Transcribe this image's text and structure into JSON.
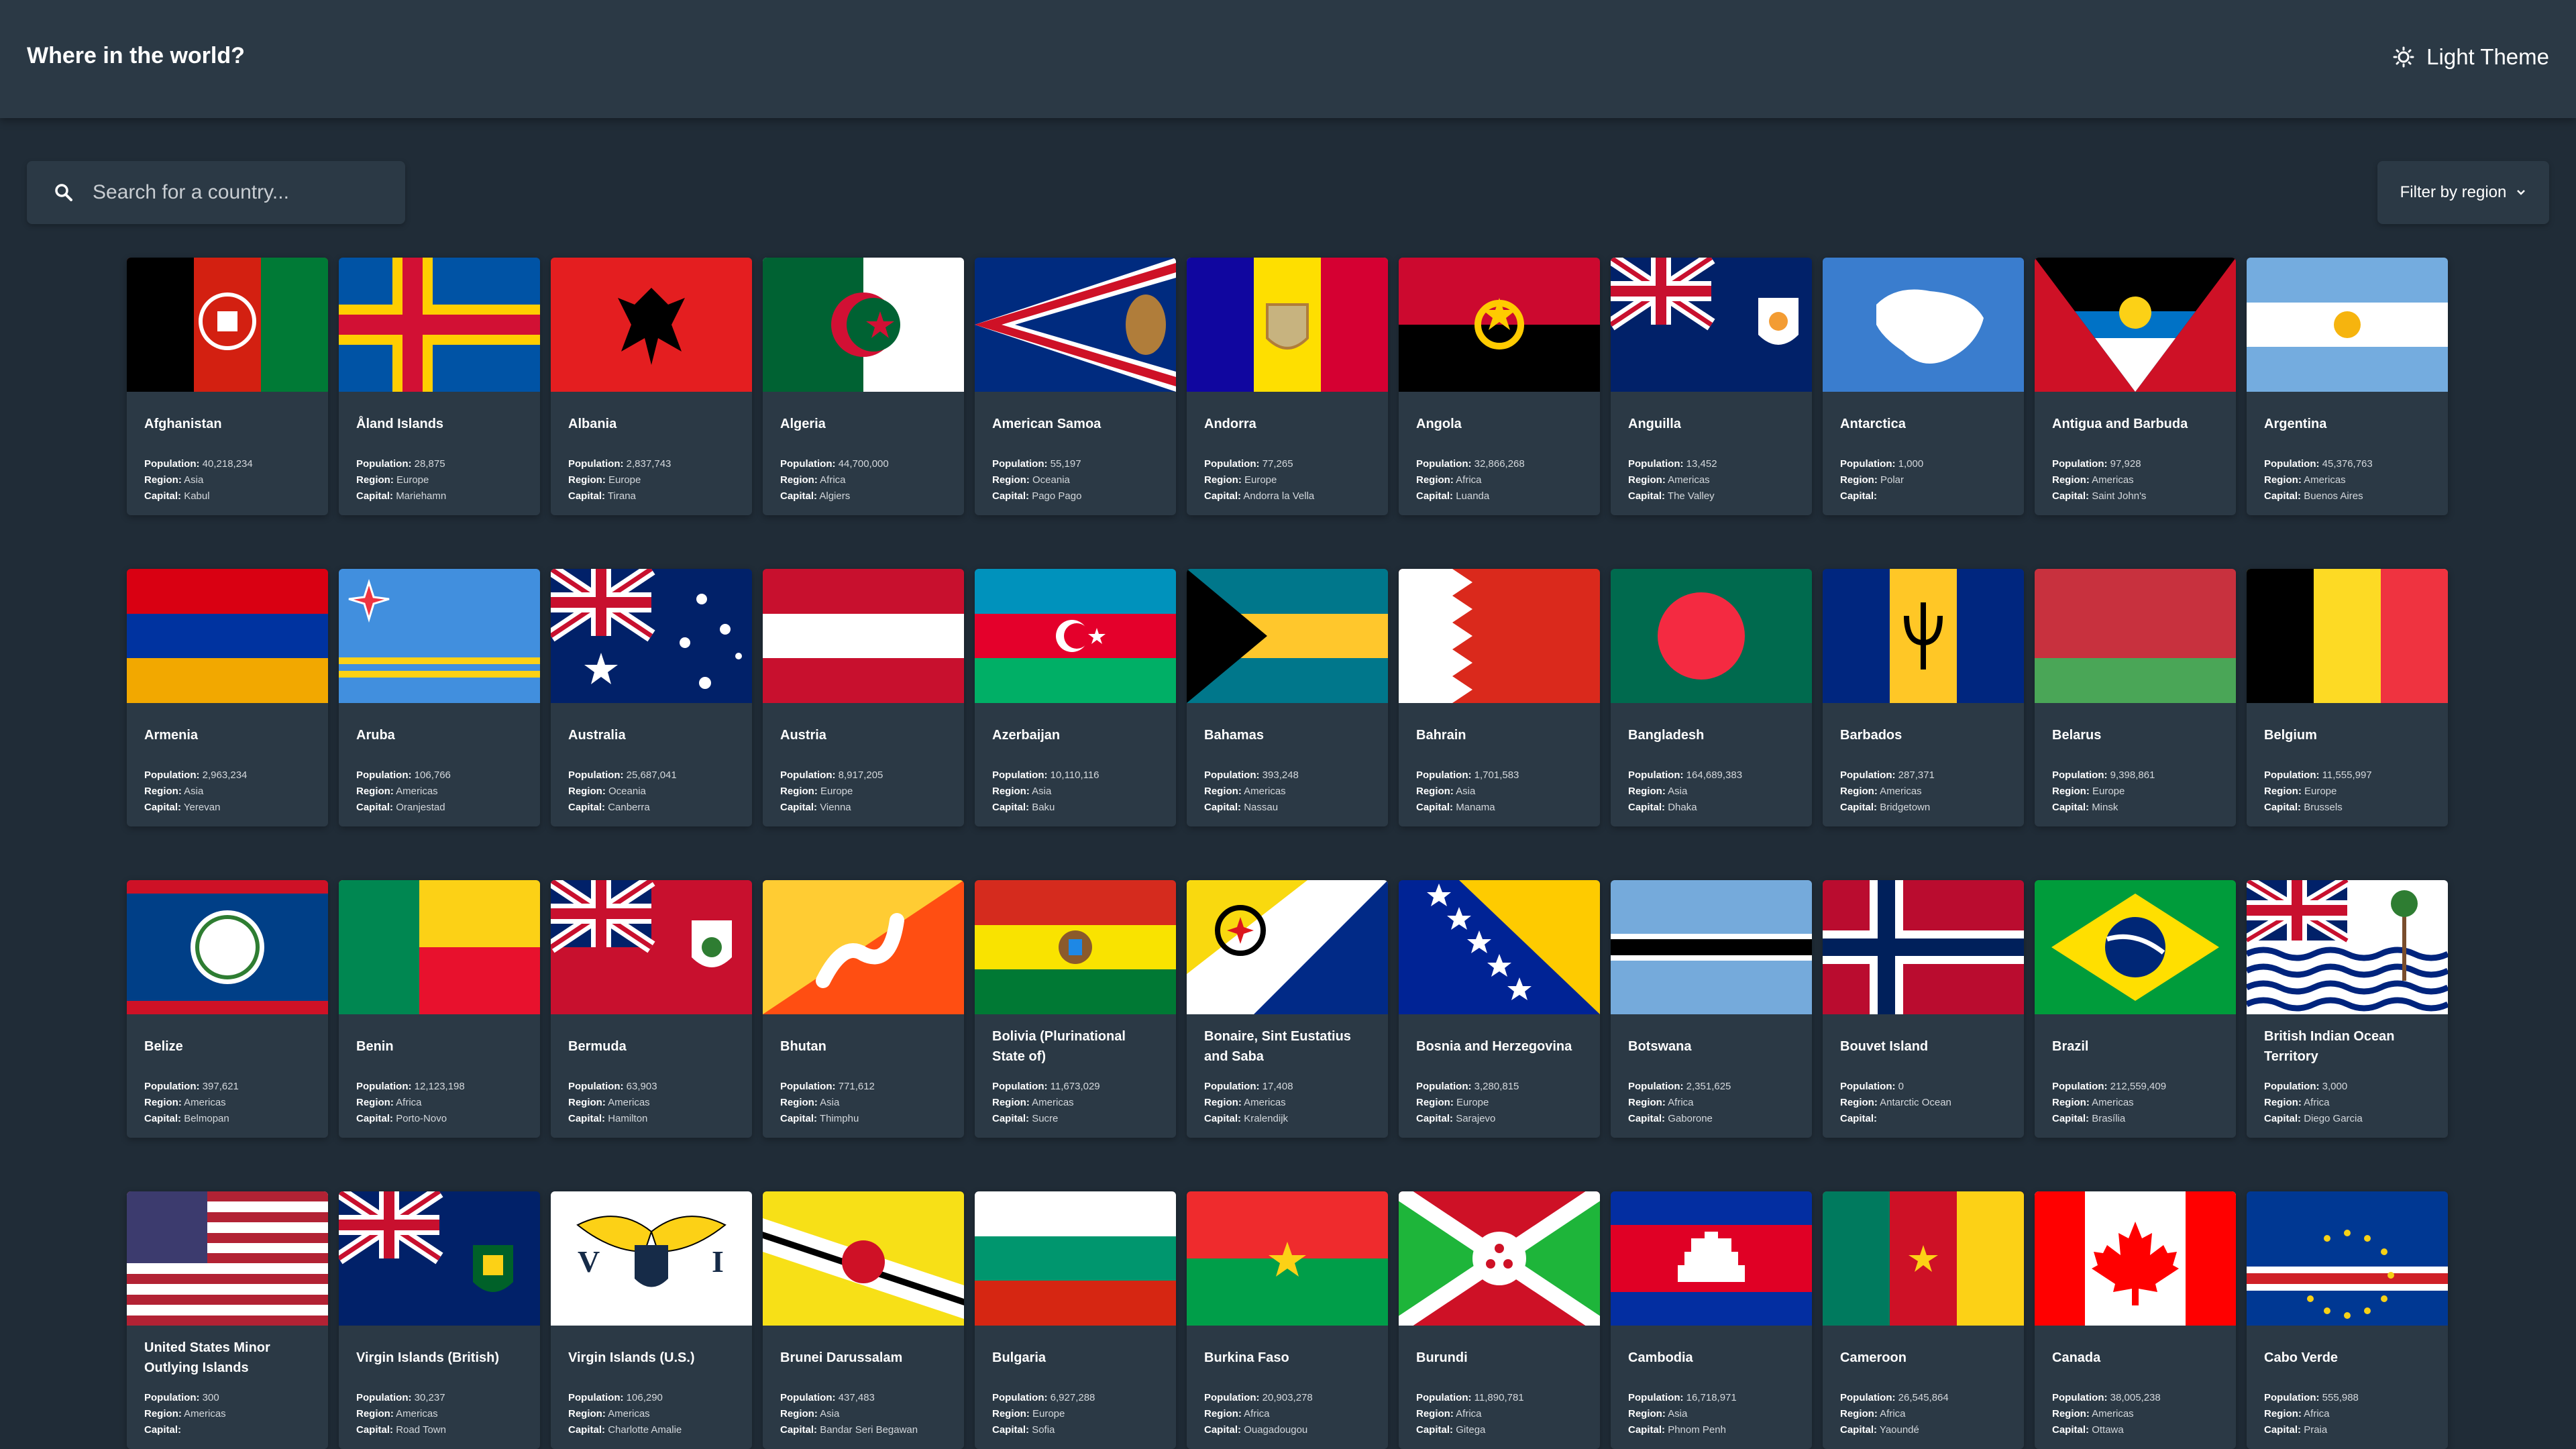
{
  "header": {
    "title": "Where in the world?",
    "theme_label": "Light Theme"
  },
  "search": {
    "placeholder": "Search for a country..."
  },
  "filter": {
    "label": "Filter by region"
  },
  "labels": {
    "population": "Population:",
    "region": "Region:",
    "capital": "Capital:"
  },
  "colors": {
    "background": "#202c37",
    "surface": "#2b3945",
    "text": "#ffffff"
  },
  "countries": [
    {
      "name": "Afghanistan",
      "population": "40,218,234",
      "region": "Asia",
      "capital": "Kabul"
    },
    {
      "name": "Åland Islands",
      "population": "28,875",
      "region": "Europe",
      "capital": "Mariehamn"
    },
    {
      "name": "Albania",
      "population": "2,837,743",
      "region": "Europe",
      "capital": "Tirana"
    },
    {
      "name": "Algeria",
      "population": "44,700,000",
      "region": "Africa",
      "capital": "Algiers"
    },
    {
      "name": "American Samoa",
      "population": "55,197",
      "region": "Oceania",
      "capital": "Pago Pago"
    },
    {
      "name": "Andorra",
      "population": "77,265",
      "region": "Europe",
      "capital": "Andorra la Vella"
    },
    {
      "name": "Angola",
      "population": "32,866,268",
      "region": "Africa",
      "capital": "Luanda"
    },
    {
      "name": "Anguilla",
      "population": "13,452",
      "region": "Americas",
      "capital": "The Valley"
    },
    {
      "name": "Antarctica",
      "population": "1,000",
      "region": "Polar",
      "capital": ""
    },
    {
      "name": "Antigua and Barbuda",
      "population": "97,928",
      "region": "Americas",
      "capital": "Saint John's"
    },
    {
      "name": "Argentina",
      "population": "45,376,763",
      "region": "Americas",
      "capital": "Buenos Aires"
    },
    {
      "name": "Armenia",
      "population": "2,963,234",
      "region": "Asia",
      "capital": "Yerevan"
    },
    {
      "name": "Aruba",
      "population": "106,766",
      "region": "Americas",
      "capital": "Oranjestad"
    },
    {
      "name": "Australia",
      "population": "25,687,041",
      "region": "Oceania",
      "capital": "Canberra"
    },
    {
      "name": "Austria",
      "population": "8,917,205",
      "region": "Europe",
      "capital": "Vienna"
    },
    {
      "name": "Azerbaijan",
      "population": "10,110,116",
      "region": "Asia",
      "capital": "Baku"
    },
    {
      "name": "Bahamas",
      "population": "393,248",
      "region": "Americas",
      "capital": "Nassau"
    },
    {
      "name": "Bahrain",
      "population": "1,701,583",
      "region": "Asia",
      "capital": "Manama"
    },
    {
      "name": "Bangladesh",
      "population": "164,689,383",
      "region": "Asia",
      "capital": "Dhaka"
    },
    {
      "name": "Barbados",
      "population": "287,371",
      "region": "Americas",
      "capital": "Bridgetown"
    },
    {
      "name": "Belarus",
      "population": "9,398,861",
      "region": "Europe",
      "capital": "Minsk"
    },
    {
      "name": "Belgium",
      "population": "11,555,997",
      "region": "Europe",
      "capital": "Brussels"
    },
    {
      "name": "Belize",
      "population": "397,621",
      "region": "Americas",
      "capital": "Belmopan"
    },
    {
      "name": "Benin",
      "population": "12,123,198",
      "region": "Africa",
      "capital": "Porto-Novo"
    },
    {
      "name": "Bermuda",
      "population": "63,903",
      "region": "Americas",
      "capital": "Hamilton"
    },
    {
      "name": "Bhutan",
      "population": "771,612",
      "region": "Asia",
      "capital": "Thimphu"
    },
    {
      "name": "Bolivia (Plurinational State of)",
      "population": "11,673,029",
      "region": "Americas",
      "capital": "Sucre"
    },
    {
      "name": "Bonaire, Sint Eustatius and Saba",
      "population": "17,408",
      "region": "Americas",
      "capital": "Kralendijk"
    },
    {
      "name": "Bosnia and Herzegovina",
      "population": "3,280,815",
      "region": "Europe",
      "capital": "Sarajevo"
    },
    {
      "name": "Botswana",
      "population": "2,351,625",
      "region": "Africa",
      "capital": "Gaborone"
    },
    {
      "name": "Bouvet Island",
      "population": "0",
      "region": "Antarctic Ocean",
      "capital": ""
    },
    {
      "name": "Brazil",
      "population": "212,559,409",
      "region": "Americas",
      "capital": "Brasília"
    },
    {
      "name": "British Indian Ocean Territory",
      "population": "3,000",
      "region": "Africa",
      "capital": "Diego Garcia"
    },
    {
      "name": "United States Minor Outlying Islands",
      "population": "300",
      "region": "Americas",
      "capital": ""
    },
    {
      "name": "Virgin Islands (British)",
      "population": "30,237",
      "region": "Americas",
      "capital": "Road Town"
    },
    {
      "name": "Virgin Islands (U.S.)",
      "population": "106,290",
      "region": "Americas",
      "capital": "Charlotte Amalie"
    },
    {
      "name": "Brunei Darussalam",
      "population": "437,483",
      "region": "Asia",
      "capital": "Bandar Seri Begawan"
    },
    {
      "name": "Bulgaria",
      "population": "6,927,288",
      "region": "Europe",
      "capital": "Sofia"
    },
    {
      "name": "Burkina Faso",
      "population": "20,903,278",
      "region": "Africa",
      "capital": "Ouagadougou"
    },
    {
      "name": "Burundi",
      "population": "11,890,781",
      "region": "Africa",
      "capital": "Gitega"
    },
    {
      "name": "Cambodia",
      "population": "16,718,971",
      "region": "Asia",
      "capital": "Phnom Penh"
    },
    {
      "name": "Cameroon",
      "population": "26,545,864",
      "region": "Africa",
      "capital": "Yaoundé"
    },
    {
      "name": "Canada",
      "population": "38,005,238",
      "region": "Americas",
      "capital": "Ottawa"
    },
    {
      "name": "Cabo Verde",
      "population": "555,988",
      "region": "Africa",
      "capital": "Praia"
    }
  ]
}
